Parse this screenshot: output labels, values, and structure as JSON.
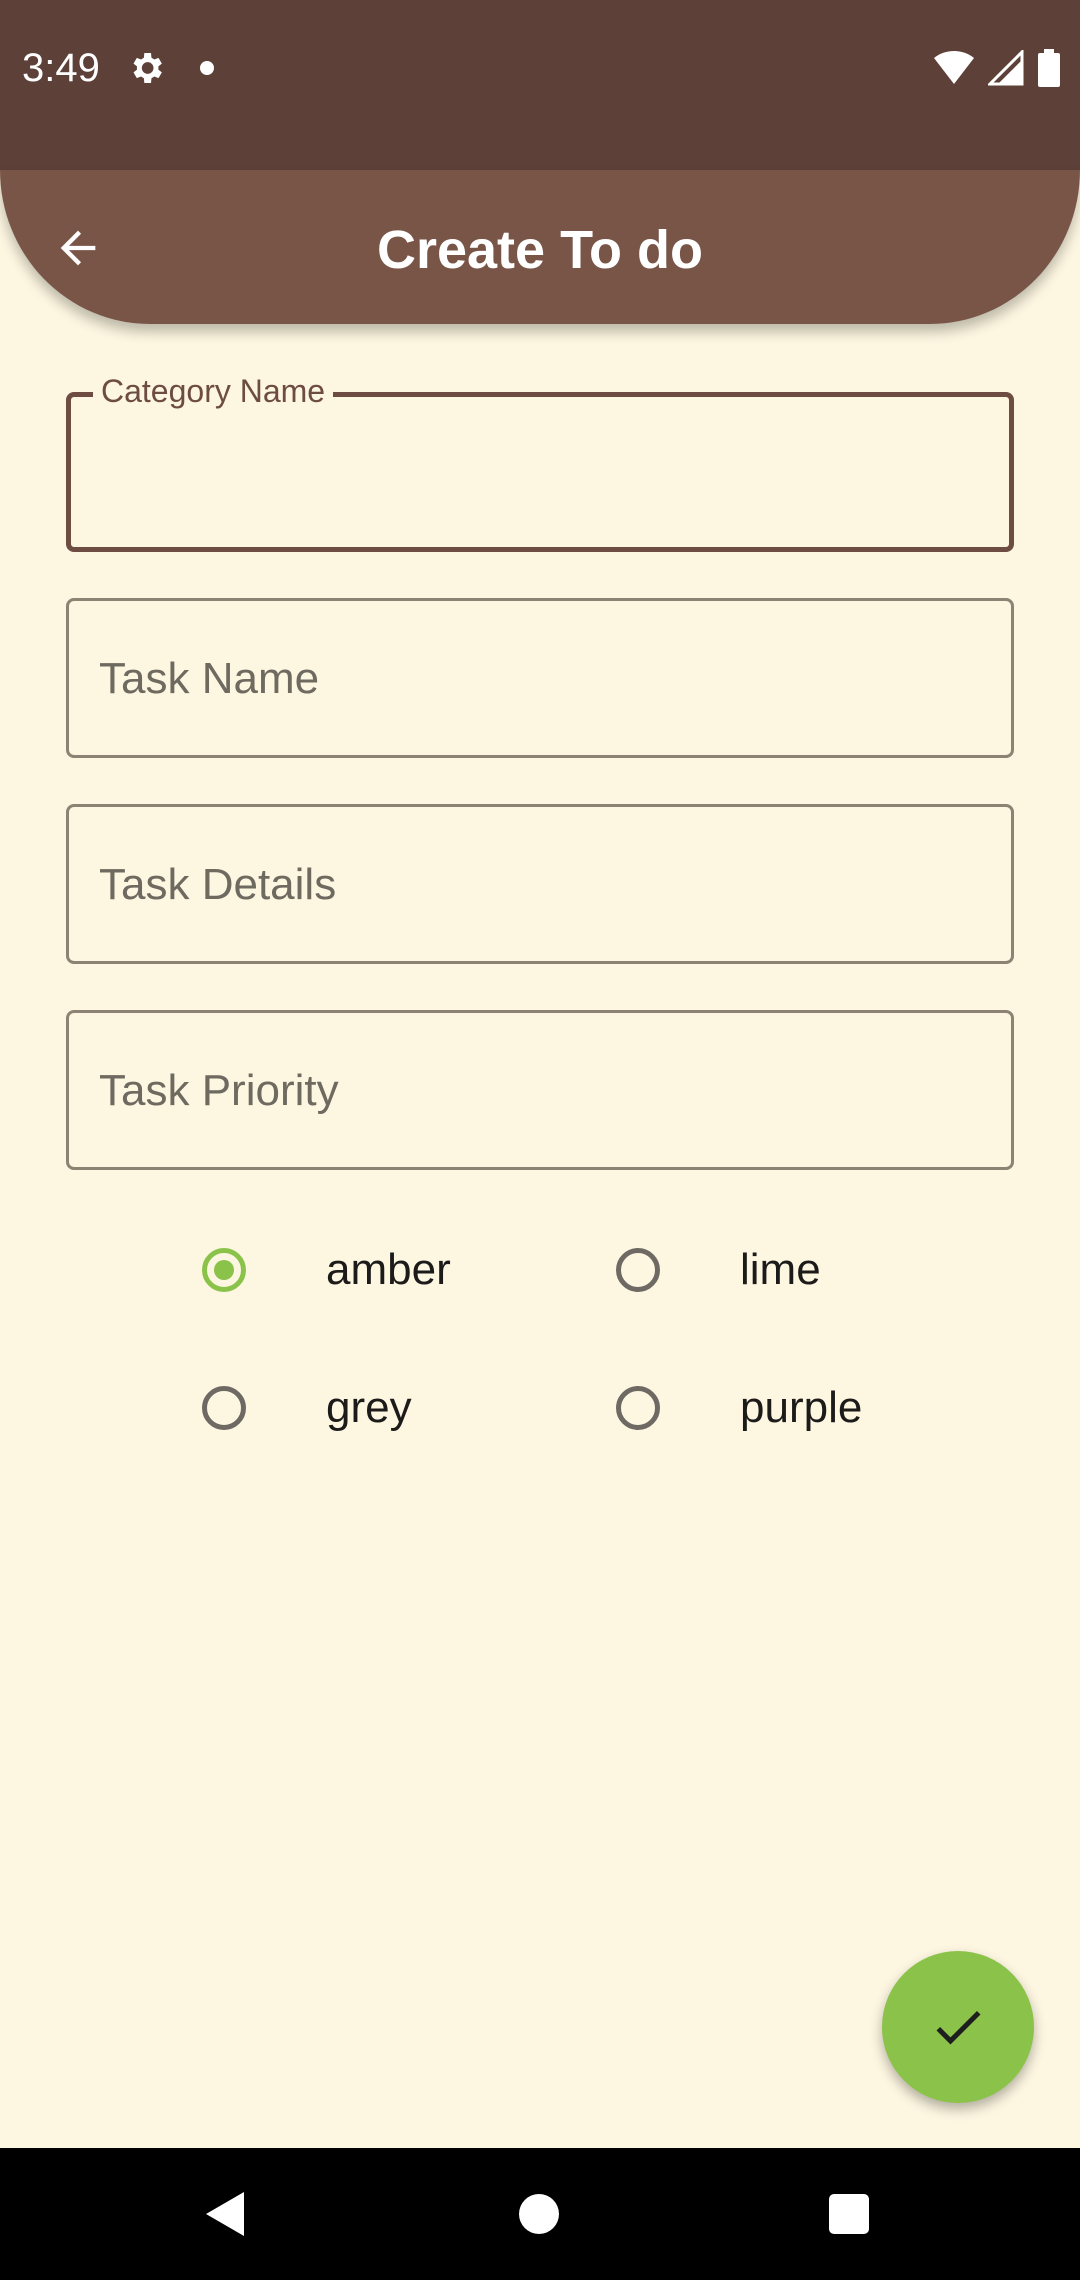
{
  "status_bar": {
    "time": "3:49",
    "icons": [
      "gear-icon",
      "dot-icon",
      "wifi-icon",
      "cell-signal-icon",
      "battery-icon"
    ]
  },
  "app_bar": {
    "title": "Create To do",
    "back_icon": "arrow-back-icon"
  },
  "form": {
    "category_name": {
      "label": "Category Name",
      "value": ""
    },
    "task_name": {
      "placeholder": "Task Name",
      "value": ""
    },
    "task_details": {
      "placeholder": "Task Details",
      "value": ""
    },
    "task_priority": {
      "placeholder": "Task Priority",
      "value": ""
    }
  },
  "colors_radio": {
    "options": [
      "amber",
      "lime",
      "grey",
      "purple"
    ],
    "selected": "amber"
  },
  "fab": {
    "icon": "check-icon"
  },
  "theme": {
    "status_bar": "#5D4037",
    "app_bar": "#795548",
    "background": "#FDF6E1",
    "accent": "#8BC34A"
  },
  "nav_bar": {
    "icons": [
      "nav-back-icon",
      "nav-home-icon",
      "nav-recents-icon"
    ]
  }
}
